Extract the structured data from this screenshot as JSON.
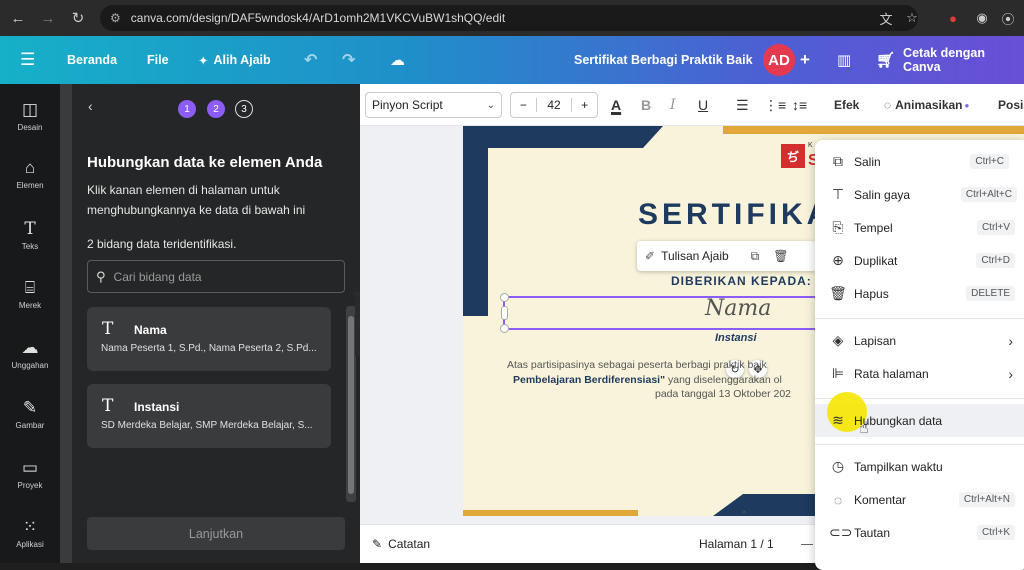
{
  "browser": {
    "url": "canva.com/design/DAF5wndosk4/ArD1omh2M1VKCVuBW1shQQ/edit"
  },
  "topbar": {
    "menu_icon": "hamburger-icon",
    "home": "Beranda",
    "file": "File",
    "magic": "Alih Ajaib",
    "design_title": "Sertifikat Berbagi Praktik Baik",
    "avatar": "AD",
    "print": "Cetak dengan Canva"
  },
  "rail": [
    {
      "icon": "layout-icon",
      "label": "Desain"
    },
    {
      "icon": "shapes-icon",
      "label": "Elemen"
    },
    {
      "icon": "text-icon",
      "label": "Teks"
    },
    {
      "icon": "brand-icon",
      "label": "Merek"
    },
    {
      "icon": "upload-icon",
      "label": "Unggahan"
    },
    {
      "icon": "draw-icon",
      "label": "Gambar"
    },
    {
      "icon": "folder-icon",
      "label": "Proyek"
    },
    {
      "icon": "apps-icon",
      "label": "Aplikasi"
    }
  ],
  "panel": {
    "steps": [
      "1",
      "2",
      "3"
    ],
    "title": "Hubungkan data ke elemen Anda",
    "description": "Klik kanan elemen di halaman untuk menghubungkannya ke data di bawah ini",
    "count": "2 bidang data teridentifikasi.",
    "search_placeholder": "Cari bidang data",
    "fields": [
      {
        "name": "Nama",
        "values": "Nama Peserta 1, S.Pd., Nama Peserta 2, S.Pd..."
      },
      {
        "name": "Instansi",
        "values": "SD Merdeka Belajar, SMP Merdeka Belajar, S..."
      }
    ],
    "next_button": "Lanjutkan"
  },
  "toolbar": {
    "font": "Pinyon Script",
    "size": "42",
    "effects": "Efek",
    "animate": "Animasikan",
    "position": "Posisi"
  },
  "canvas": {
    "logo_top": "K",
    "logo_letter": "S",
    "heading": "SERTIFIKA",
    "magic_write": "Tulisan Ajaib",
    "given_to": "DIBERIKAN KEPADA:",
    "name_placeholder": "Nama",
    "institution": "Instansi",
    "body_line1": "Atas partisipasinya sebagai peserta berbagi praktik baik",
    "body_line2_bold": "Pembelajaran Berdiferensiasi\"",
    "body_line2": "yang diselenggarakan ol",
    "body_line3": "pada tanggal 13 Oktober 202"
  },
  "footer": {
    "notes": "Catatan",
    "page": "Halaman 1 / 1"
  },
  "context_menu": [
    {
      "icon": "copy-icon",
      "label": "Salin",
      "shortcut": "Ctrl+C"
    },
    {
      "icon": "paint-roller-icon",
      "label": "Salin gaya",
      "shortcut": "Ctrl+Alt+C"
    },
    {
      "icon": "paste-icon",
      "label": "Tempel",
      "shortcut": "Ctrl+V"
    },
    {
      "icon": "duplicate-icon",
      "label": "Duplikat",
      "shortcut": "Ctrl+D"
    },
    {
      "icon": "trash-icon",
      "label": "Hapus",
      "shortcut": "DELETE"
    },
    {
      "icon": "layers-icon",
      "label": "Lapisan",
      "shortcut": ""
    },
    {
      "icon": "align-page-icon",
      "label": "Rata halaman",
      "shortcut": ""
    },
    {
      "icon": "database-icon",
      "label": "Hubungkan data",
      "shortcut": ""
    },
    {
      "icon": "clock-icon",
      "label": "Tampilkan waktu",
      "shortcut": ""
    },
    {
      "icon": "comment-icon",
      "label": "Komentar",
      "shortcut": "Ctrl+Alt+N"
    },
    {
      "icon": "link-icon",
      "label": "Tautan",
      "shortcut": "Ctrl+K"
    }
  ],
  "colors": {
    "accent_purple": "#8b5cf6",
    "highlight_yellow": "#f5e600",
    "certificate_navy": "#1e3a5f",
    "certificate_gold": "#e0a83a"
  }
}
